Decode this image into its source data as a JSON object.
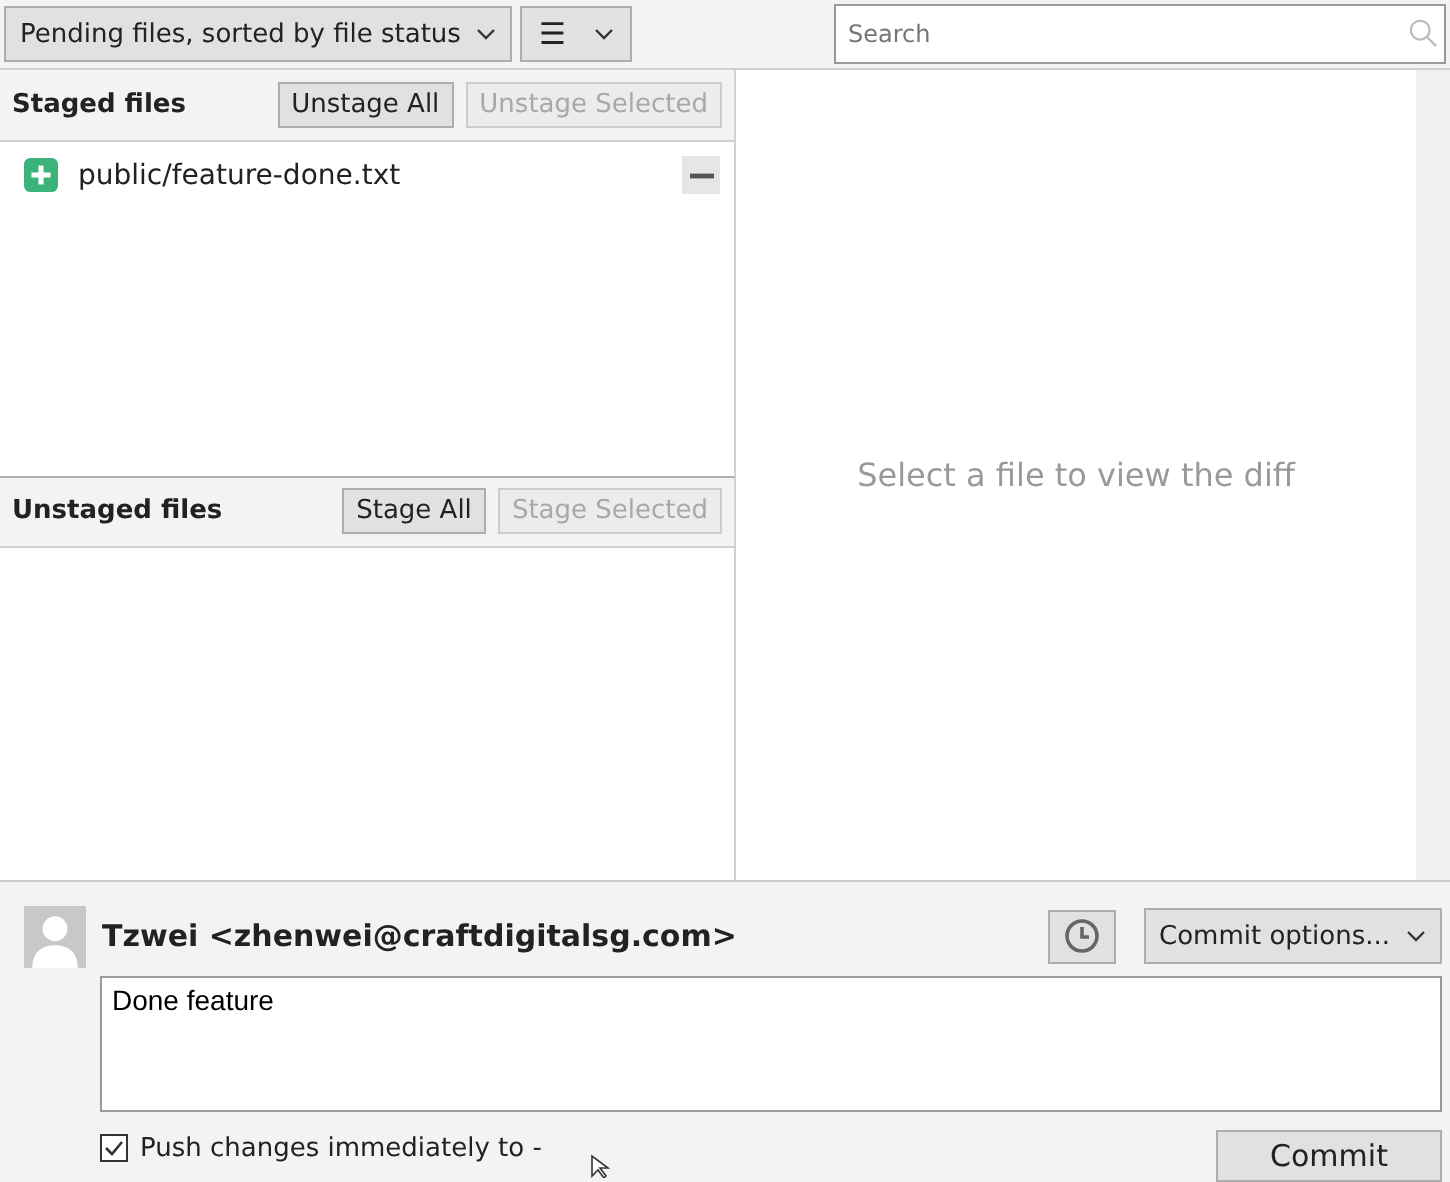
{
  "toolbar": {
    "view_dropdown": "Pending files, sorted by file status",
    "list_mode_button": "☰",
    "search": {
      "placeholder": "Search"
    }
  },
  "staged": {
    "title": "Staged files",
    "buttons": [
      {
        "label": "Unstage All",
        "disabled": false
      },
      {
        "label": "Unstage Selected",
        "disabled": true
      }
    ],
    "files": [
      {
        "path": "public/feature-done.txt",
        "kind": "added"
      }
    ]
  },
  "unstaged": {
    "title": "Unstaged files",
    "buttons": [
      {
        "label": "Stage All",
        "disabled": false
      },
      {
        "label": "Stage Selected",
        "disabled": true
      }
    ]
  },
  "diff": {
    "message": "Select a file to view the diff"
  },
  "commit": {
    "author": "Tzwei <zhenwei@craftdigitalsg.com>",
    "options_button": "Commit options...",
    "message": "Done feature",
    "push": {
      "label": "Push changes immediately to -",
      "checked": true
    },
    "commit_button": "Commit"
  }
}
